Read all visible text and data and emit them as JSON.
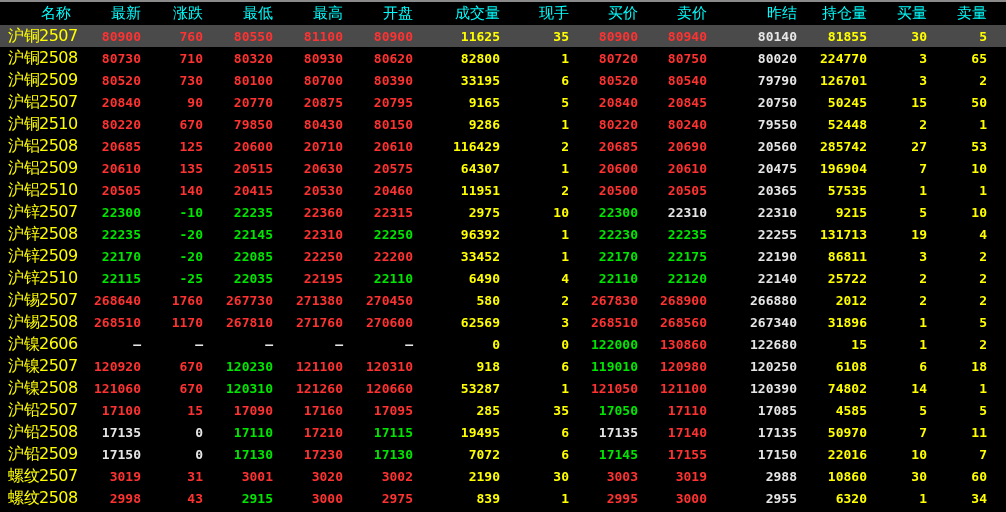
{
  "columns": [
    {
      "label": "名称",
      "kind": "name"
    },
    {
      "label": "最新",
      "kind": "price"
    },
    {
      "label": "涨跌",
      "kind": "price"
    },
    {
      "label": "最低",
      "kind": "price"
    },
    {
      "label": "最高",
      "kind": "price"
    },
    {
      "label": "开盘",
      "kind": "price"
    },
    {
      "label": "成交量",
      "kind": "volume"
    },
    {
      "label": "现手",
      "kind": "volume"
    },
    {
      "label": "买价",
      "kind": "price"
    },
    {
      "label": "卖价",
      "kind": "price"
    },
    {
      "label": "昨结",
      "kind": "price"
    },
    {
      "label": "持仓量",
      "kind": "volume"
    },
    {
      "label": "买量",
      "kind": "volume"
    },
    {
      "label": "卖量",
      "kind": "volume"
    }
  ],
  "rows": [
    {
      "name": "沪铜2507",
      "selected": true,
      "cells": [
        {
          "text": "80900",
          "color": "#ff3232"
        },
        {
          "text": "760",
          "color": "#ff3232"
        },
        {
          "text": "80550",
          "color": "#ff3232"
        },
        {
          "text": "81100",
          "color": "#ff3232"
        },
        {
          "text": "80900",
          "color": "#ff3232"
        },
        "11625",
        "35",
        {
          "text": "80900",
          "color": "#ff3232"
        },
        {
          "text": "80940",
          "color": "#ff3232"
        },
        {
          "text": "80140",
          "color": "#e6e6e6"
        },
        "81855",
        "30",
        "5"
      ]
    },
    {
      "name": "沪铜2508",
      "selected": false,
      "cells": [
        {
          "text": "80730",
          "color": "#ff3232"
        },
        {
          "text": "710",
          "color": "#ff3232"
        },
        {
          "text": "80320",
          "color": "#ff3232"
        },
        {
          "text": "80930",
          "color": "#ff3232"
        },
        {
          "text": "80620",
          "color": "#ff3232"
        },
        "82800",
        "1",
        {
          "text": "80720",
          "color": "#ff3232"
        },
        {
          "text": "80750",
          "color": "#ff3232"
        },
        {
          "text": "80020",
          "color": "#e6e6e6"
        },
        "224770",
        "3",
        "65"
      ]
    },
    {
      "name": "沪铜2509",
      "selected": false,
      "cells": [
        {
          "text": "80520",
          "color": "#ff3232"
        },
        {
          "text": "730",
          "color": "#ff3232"
        },
        {
          "text": "80100",
          "color": "#ff3232"
        },
        {
          "text": "80700",
          "color": "#ff3232"
        },
        {
          "text": "80390",
          "color": "#ff3232"
        },
        "33195",
        "6",
        {
          "text": "80520",
          "color": "#ff3232"
        },
        {
          "text": "80540",
          "color": "#ff3232"
        },
        {
          "text": "79790",
          "color": "#e6e6e6"
        },
        "126701",
        "3",
        "2"
      ]
    },
    {
      "name": "沪铝2507",
      "selected": false,
      "cells": [
        {
          "text": "20840",
          "color": "#ff3232"
        },
        {
          "text": "90",
          "color": "#ff3232"
        },
        {
          "text": "20770",
          "color": "#ff3232"
        },
        {
          "text": "20875",
          "color": "#ff3232"
        },
        {
          "text": "20795",
          "color": "#ff3232"
        },
        "9165",
        "5",
        {
          "text": "20840",
          "color": "#ff3232"
        },
        {
          "text": "20845",
          "color": "#ff3232"
        },
        {
          "text": "20750",
          "color": "#e6e6e6"
        },
        "50245",
        "15",
        "50"
      ]
    },
    {
      "name": "沪铜2510",
      "selected": false,
      "cells": [
        {
          "text": "80220",
          "color": "#ff3232"
        },
        {
          "text": "670",
          "color": "#ff3232"
        },
        {
          "text": "79850",
          "color": "#ff3232"
        },
        {
          "text": "80430",
          "color": "#ff3232"
        },
        {
          "text": "80150",
          "color": "#ff3232"
        },
        "9286",
        "1",
        {
          "text": "80220",
          "color": "#ff3232"
        },
        {
          "text": "80240",
          "color": "#ff3232"
        },
        {
          "text": "79550",
          "color": "#e6e6e6"
        },
        "52448",
        "2",
        "1"
      ]
    },
    {
      "name": "沪铝2508",
      "selected": false,
      "cells": [
        {
          "text": "20685",
          "color": "#ff3232"
        },
        {
          "text": "125",
          "color": "#ff3232"
        },
        {
          "text": "20600",
          "color": "#ff3232"
        },
        {
          "text": "20710",
          "color": "#ff3232"
        },
        {
          "text": "20610",
          "color": "#ff3232"
        },
        "116429",
        "2",
        {
          "text": "20685",
          "color": "#ff3232"
        },
        {
          "text": "20690",
          "color": "#ff3232"
        },
        {
          "text": "20560",
          "color": "#e6e6e6"
        },
        "285742",
        "27",
        "53"
      ]
    },
    {
      "name": "沪铝2509",
      "selected": false,
      "cells": [
        {
          "text": "20610",
          "color": "#ff3232"
        },
        {
          "text": "135",
          "color": "#ff3232"
        },
        {
          "text": "20515",
          "color": "#ff3232"
        },
        {
          "text": "20630",
          "color": "#ff3232"
        },
        {
          "text": "20575",
          "color": "#ff3232"
        },
        "64307",
        "1",
        {
          "text": "20600",
          "color": "#ff3232"
        },
        {
          "text": "20610",
          "color": "#ff3232"
        },
        {
          "text": "20475",
          "color": "#e6e6e6"
        },
        "196904",
        "7",
        "10"
      ]
    },
    {
      "name": "沪铝2510",
      "selected": false,
      "cells": [
        {
          "text": "20505",
          "color": "#ff3232"
        },
        {
          "text": "140",
          "color": "#ff3232"
        },
        {
          "text": "20415",
          "color": "#ff3232"
        },
        {
          "text": "20530",
          "color": "#ff3232"
        },
        {
          "text": "20460",
          "color": "#ff3232"
        },
        "11951",
        "2",
        {
          "text": "20500",
          "color": "#ff3232"
        },
        {
          "text": "20505",
          "color": "#ff3232"
        },
        {
          "text": "20365",
          "color": "#e6e6e6"
        },
        "57535",
        "1",
        "1"
      ]
    },
    {
      "name": "沪锌2507",
      "selected": false,
      "cells": [
        {
          "text": "22300",
          "color": "#00e600"
        },
        {
          "text": "-10",
          "color": "#00e600"
        },
        {
          "text": "22235",
          "color": "#00e600"
        },
        {
          "text": "22360",
          "color": "#ff3232"
        },
        {
          "text": "22315",
          "color": "#ff3232"
        },
        "2975",
        "10",
        {
          "text": "22300",
          "color": "#00e600"
        },
        {
          "text": "22310",
          "color": "#e6e6e6"
        },
        {
          "text": "22310",
          "color": "#e6e6e6"
        },
        "9215",
        "5",
        "10"
      ]
    },
    {
      "name": "沪锌2508",
      "selected": false,
      "cells": [
        {
          "text": "22235",
          "color": "#00e600"
        },
        {
          "text": "-20",
          "color": "#00e600"
        },
        {
          "text": "22145",
          "color": "#00e600"
        },
        {
          "text": "22310",
          "color": "#ff3232"
        },
        {
          "text": "22250",
          "color": "#00e600"
        },
        "96392",
        "1",
        {
          "text": "22230",
          "color": "#00e600"
        },
        {
          "text": "22235",
          "color": "#00e600"
        },
        {
          "text": "22255",
          "color": "#e6e6e6"
        },
        "131713",
        "19",
        "4"
      ]
    },
    {
      "name": "沪锌2509",
      "selected": false,
      "cells": [
        {
          "text": "22170",
          "color": "#00e600"
        },
        {
          "text": "-20",
          "color": "#00e600"
        },
        {
          "text": "22085",
          "color": "#00e600"
        },
        {
          "text": "22250",
          "color": "#ff3232"
        },
        {
          "text": "22200",
          "color": "#ff3232"
        },
        "33452",
        "1",
        {
          "text": "22170",
          "color": "#00e600"
        },
        {
          "text": "22175",
          "color": "#00e600"
        },
        {
          "text": "22190",
          "color": "#e6e6e6"
        },
        "86811",
        "3",
        "2"
      ]
    },
    {
      "name": "沪锌2510",
      "selected": false,
      "cells": [
        {
          "text": "22115",
          "color": "#00e600"
        },
        {
          "text": "-25",
          "color": "#00e600"
        },
        {
          "text": "22035",
          "color": "#00e600"
        },
        {
          "text": "22195",
          "color": "#ff3232"
        },
        {
          "text": "22110",
          "color": "#00e600"
        },
        "6490",
        "4",
        {
          "text": "22110",
          "color": "#00e600"
        },
        {
          "text": "22120",
          "color": "#00e600"
        },
        {
          "text": "22140",
          "color": "#e6e6e6"
        },
        "25722",
        "2",
        "2"
      ]
    },
    {
      "name": "沪锡2507",
      "selected": false,
      "cells": [
        {
          "text": "268640",
          "color": "#ff3232"
        },
        {
          "text": "1760",
          "color": "#ff3232"
        },
        {
          "text": "267730",
          "color": "#ff3232"
        },
        {
          "text": "271380",
          "color": "#ff3232"
        },
        {
          "text": "270450",
          "color": "#ff3232"
        },
        "580",
        "2",
        {
          "text": "267830",
          "color": "#ff3232"
        },
        {
          "text": "268900",
          "color": "#ff3232"
        },
        {
          "text": "266880",
          "color": "#e6e6e6"
        },
        "2012",
        "2",
        "2"
      ]
    },
    {
      "name": "沪锡2508",
      "selected": false,
      "cells": [
        {
          "text": "268510",
          "color": "#ff3232"
        },
        {
          "text": "1170",
          "color": "#ff3232"
        },
        {
          "text": "267810",
          "color": "#ff3232"
        },
        {
          "text": "271760",
          "color": "#ff3232"
        },
        {
          "text": "270600",
          "color": "#ff3232"
        },
        "62569",
        "3",
        {
          "text": "268510",
          "color": "#ff3232"
        },
        {
          "text": "268560",
          "color": "#ff3232"
        },
        {
          "text": "267340",
          "color": "#e6e6e6"
        },
        "31896",
        "1",
        "5"
      ]
    },
    {
      "name": "沪镍2606",
      "selected": false,
      "cells": [
        {
          "text": "—",
          "color": "#e6e6e6"
        },
        {
          "text": "—",
          "color": "#e6e6e6"
        },
        {
          "text": "—",
          "color": "#e6e6e6"
        },
        {
          "text": "—",
          "color": "#e6e6e6"
        },
        {
          "text": "—",
          "color": "#e6e6e6"
        },
        "0",
        "0",
        {
          "text": "122000",
          "color": "#00e600"
        },
        {
          "text": "130860",
          "color": "#ff3232"
        },
        {
          "text": "122680",
          "color": "#e6e6e6"
        },
        "15",
        "1",
        "2"
      ]
    },
    {
      "name": "沪镍2507",
      "selected": false,
      "cells": [
        {
          "text": "120920",
          "color": "#ff3232"
        },
        {
          "text": "670",
          "color": "#ff3232"
        },
        {
          "text": "120230",
          "color": "#00e600"
        },
        {
          "text": "121100",
          "color": "#ff3232"
        },
        {
          "text": "120310",
          "color": "#ff3232"
        },
        "918",
        "6",
        {
          "text": "119010",
          "color": "#00e600"
        },
        {
          "text": "120980",
          "color": "#ff3232"
        },
        {
          "text": "120250",
          "color": "#e6e6e6"
        },
        "6108",
        "6",
        "18"
      ]
    },
    {
      "name": "沪镍2508",
      "selected": false,
      "cells": [
        {
          "text": "121060",
          "color": "#ff3232"
        },
        {
          "text": "670",
          "color": "#ff3232"
        },
        {
          "text": "120310",
          "color": "#00e600"
        },
        {
          "text": "121260",
          "color": "#ff3232"
        },
        {
          "text": "120660",
          "color": "#ff3232"
        },
        "53287",
        "1",
        {
          "text": "121050",
          "color": "#ff3232"
        },
        {
          "text": "121100",
          "color": "#ff3232"
        },
        {
          "text": "120390",
          "color": "#e6e6e6"
        },
        "74802",
        "14",
        "1"
      ]
    },
    {
      "name": "沪铅2507",
      "selected": false,
      "cells": [
        {
          "text": "17100",
          "color": "#ff3232"
        },
        {
          "text": "15",
          "color": "#ff3232"
        },
        {
          "text": "17090",
          "color": "#ff3232"
        },
        {
          "text": "17160",
          "color": "#ff3232"
        },
        {
          "text": "17095",
          "color": "#ff3232"
        },
        "285",
        "35",
        {
          "text": "17050",
          "color": "#00e600"
        },
        {
          "text": "17110",
          "color": "#ff3232"
        },
        {
          "text": "17085",
          "color": "#e6e6e6"
        },
        "4585",
        "5",
        "5"
      ]
    },
    {
      "name": "沪铅2508",
      "selected": false,
      "cells": [
        {
          "text": "17135",
          "color": "#e6e6e6"
        },
        {
          "text": "0",
          "color": "#e6e6e6"
        },
        {
          "text": "17110",
          "color": "#00e600"
        },
        {
          "text": "17210",
          "color": "#ff3232"
        },
        {
          "text": "17115",
          "color": "#00e600"
        },
        "19495",
        "6",
        {
          "text": "17135",
          "color": "#e6e6e6"
        },
        {
          "text": "17140",
          "color": "#ff3232"
        },
        {
          "text": "17135",
          "color": "#e6e6e6"
        },
        "50970",
        "7",
        "11"
      ]
    },
    {
      "name": "沪铅2509",
      "selected": false,
      "cells": [
        {
          "text": "17150",
          "color": "#e6e6e6"
        },
        {
          "text": "0",
          "color": "#e6e6e6"
        },
        {
          "text": "17130",
          "color": "#00e600"
        },
        {
          "text": "17230",
          "color": "#ff3232"
        },
        {
          "text": "17130",
          "color": "#00e600"
        },
        "7072",
        "6",
        {
          "text": "17145",
          "color": "#00e600"
        },
        {
          "text": "17155",
          "color": "#ff3232"
        },
        {
          "text": "17150",
          "color": "#e6e6e6"
        },
        "22016",
        "10",
        "7"
      ]
    },
    {
      "name": "螺纹2507",
      "selected": false,
      "cells": [
        {
          "text": "3019",
          "color": "#ff3232"
        },
        {
          "text": "31",
          "color": "#ff3232"
        },
        {
          "text": "3001",
          "color": "#ff3232"
        },
        {
          "text": "3020",
          "color": "#ff3232"
        },
        {
          "text": "3002",
          "color": "#ff3232"
        },
        "2190",
        "30",
        {
          "text": "3003",
          "color": "#ff3232"
        },
        {
          "text": "3019",
          "color": "#ff3232"
        },
        {
          "text": "2988",
          "color": "#e6e6e6"
        },
        "10860",
        "30",
        "60"
      ]
    },
    {
      "name": "螺纹2508",
      "selected": false,
      "cells": [
        {
          "text": "2998",
          "color": "#ff3232"
        },
        {
          "text": "43",
          "color": "#ff3232"
        },
        {
          "text": "2915",
          "color": "#00e600"
        },
        {
          "text": "3000",
          "color": "#ff3232"
        },
        {
          "text": "2975",
          "color": "#ff3232"
        },
        "839",
        "1",
        {
          "text": "2995",
          "color": "#ff3232"
        },
        {
          "text": "3000",
          "color": "#ff3232"
        },
        {
          "text": "2955",
          "color": "#e6e6e6"
        },
        "6320",
        "1",
        "34"
      ]
    }
  ]
}
